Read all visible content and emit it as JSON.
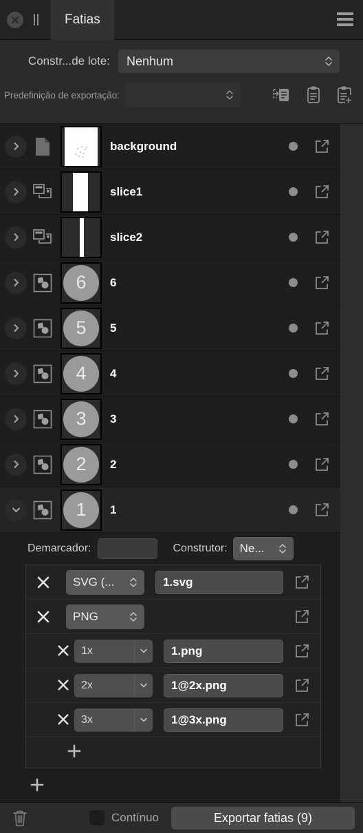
{
  "titlebar": {
    "close_icon": "close-circle-icon",
    "grip_icon": "grip-handle-icon",
    "tab_label": "Fatias",
    "menu_icon": "hamburger-menu-icon"
  },
  "controls": {
    "batch_label": "Constr...de lote:",
    "batch_value": "Nenhum",
    "preset_label": "Predefinição de exportação:",
    "preset_value": "",
    "icons": [
      "apply-preset-icon",
      "clipboard-icon",
      "clipboard-add-icon"
    ]
  },
  "layers": [
    {
      "name": "background",
      "type_icon": "document-icon",
      "thumb": "speckled-white",
      "expanded": false,
      "chevron": "chevron-right-icon",
      "status_dot": "status-dot",
      "export_icon": "external-link-icon"
    },
    {
      "name": "slice1",
      "type_icon": "slice-icon",
      "thumb": "wide-bar",
      "expanded": false,
      "chevron": "chevron-right-icon",
      "status_dot": "status-dot",
      "export_icon": "external-link-icon"
    },
    {
      "name": "slice2",
      "type_icon": "slice-icon",
      "thumb": "thin-bar",
      "expanded": false,
      "chevron": "chevron-right-icon",
      "status_dot": "status-dot",
      "export_icon": "external-link-icon"
    },
    {
      "name": "6",
      "type_icon": "group-shapes-icon",
      "thumb": "circle",
      "thumb_text": "6",
      "expanded": false,
      "chevron": "chevron-right-icon",
      "status_dot": "status-dot",
      "export_icon": "external-link-icon"
    },
    {
      "name": "5",
      "type_icon": "group-shapes-icon",
      "thumb": "circle",
      "thumb_text": "5",
      "expanded": false,
      "chevron": "chevron-right-icon",
      "status_dot": "status-dot",
      "export_icon": "external-link-icon"
    },
    {
      "name": "4",
      "type_icon": "group-shapes-icon",
      "thumb": "circle",
      "thumb_text": "4",
      "expanded": false,
      "chevron": "chevron-right-icon",
      "status_dot": "status-dot",
      "export_icon": "external-link-icon"
    },
    {
      "name": "3",
      "type_icon": "group-shapes-icon",
      "thumb": "circle",
      "thumb_text": "3",
      "expanded": false,
      "chevron": "chevron-right-icon",
      "status_dot": "status-dot",
      "export_icon": "external-link-icon"
    },
    {
      "name": "2",
      "type_icon": "group-shapes-icon",
      "thumb": "circle",
      "thumb_text": "2",
      "expanded": false,
      "chevron": "chevron-right-icon",
      "status_dot": "status-dot",
      "export_icon": "external-link-icon"
    },
    {
      "name": "1",
      "type_icon": "group-shapes-icon",
      "thumb": "circle",
      "thumb_text": "1",
      "expanded": true,
      "chevron": "chevron-down-icon",
      "status_dot": "status-dot",
      "export_icon": "external-link-icon"
    }
  ],
  "detail": {
    "marker_label": "Demarcador:",
    "marker_value": "",
    "builder_label": "Construtor:",
    "builder_value": "Ne...",
    "exports": [
      {
        "format": "SVG (...",
        "filename": "1.svg",
        "scale": null,
        "indent": false
      },
      {
        "format": "PNG",
        "filename": "",
        "scale": null,
        "indent": false
      },
      {
        "format": null,
        "scale": "1x",
        "filename": "1.png",
        "indent": true
      },
      {
        "format": null,
        "scale": "2x",
        "filename": "1@2x.png",
        "indent": true
      },
      {
        "format": null,
        "scale": "3x",
        "filename": "1@3x.png",
        "indent": true
      }
    ],
    "add_export_icon": "plus-icon",
    "add_slice_icon": "plus-icon"
  },
  "bottombar": {
    "trash_icon": "trash-icon",
    "continuous_label": "Contínuo",
    "continuous_checked": false,
    "export_button": "Exportar fatias (9)"
  }
}
